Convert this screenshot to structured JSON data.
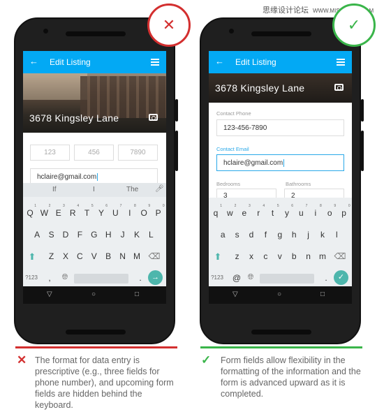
{
  "watermark": {
    "cn": "思缘设计论坛",
    "url": "WWW.MISSYUAN.COM"
  },
  "colors": {
    "appbar": "#03a9f4",
    "bad": "#d32f2f",
    "good": "#3ab54a",
    "accent": "#4db6ac"
  },
  "bad": {
    "badge": "x",
    "appbar_title": "Edit Listing",
    "address": "3678 Kingsley Lane",
    "phone_fields": [
      "123",
      "456",
      "7890"
    ],
    "email_value": "hclaire@gmail.com",
    "suggestions": [
      "If",
      "I",
      "The"
    ],
    "rows": [
      [
        "Q",
        "W",
        "E",
        "R",
        "T",
        "Y",
        "U",
        "I",
        "O",
        "P"
      ],
      [
        "A",
        "S",
        "D",
        "F",
        "G",
        "H",
        "J",
        "K",
        "L"
      ],
      [
        "Z",
        "X",
        "C",
        "V",
        "B",
        "N",
        "M"
      ]
    ],
    "bottom": {
      "sym": "?123",
      "comma": ",",
      "period": "."
    },
    "caption": "The format for data entry is prescriptive (e.g., three fields for phone number), and upcoming form fields are hidden behind the keyboard."
  },
  "good": {
    "badge": "check",
    "appbar_title": "Edit Listing",
    "address": "3678 Kingsley Lane",
    "phone_label": "Contact Phone",
    "phone_value": "123-456-7890",
    "email_label": "Contact Email",
    "email_value": "hclaire@gmail.com",
    "bedrooms_label": "Bedrooms",
    "bedrooms_value": "3",
    "bathrooms_label": "Bathrooms",
    "bathrooms_value": "2",
    "rows": [
      [
        "q",
        "w",
        "e",
        "r",
        "t",
        "y",
        "u",
        "i",
        "o",
        "p"
      ],
      [
        "a",
        "s",
        "d",
        "f",
        "g",
        "h",
        "j",
        "k",
        "l"
      ],
      [
        "z",
        "x",
        "c",
        "v",
        "b",
        "n",
        "m"
      ]
    ],
    "bottom": {
      "sym": "?123",
      "at": "@",
      "period": "."
    },
    "caption": "Form fields allow flexibility in the formatting of the information and the form is advanced upward as it is completed."
  },
  "digits": [
    "1",
    "2",
    "3",
    "4",
    "5",
    "6",
    "7",
    "8",
    "9",
    "0"
  ],
  "nav": {
    "back": "▽",
    "home": "○",
    "recents": "□"
  }
}
